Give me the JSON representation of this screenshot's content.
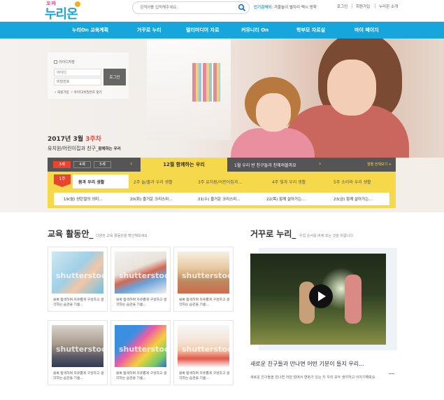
{
  "header": {
    "logo_small": "꼬마",
    "logo_main": "누리온",
    "search_placeholder": "검색어를 입력해주세요.",
    "hot_label": "인기검색어",
    "hot_text": ": 겨울놀이 별자리 팩시 방학",
    "util": [
      "로그인",
      "회원가입",
      "누리온 소개"
    ]
  },
  "nav": {
    "items": [
      "누리On 교육계획",
      "거꾸로 누리",
      "멀티미디어 자료",
      "커뮤니티 On",
      "학부모 자료실",
      "마이 페이지"
    ]
  },
  "login": {
    "keep": "아이디저장",
    "id_placeholder": "아이디",
    "pw_placeholder": "비밀번호",
    "button": "로그인",
    "link1": "회원가입",
    "link2": "아이디/비밀번호 찾기"
  },
  "hero": {
    "week_prefix": "2017년 3월 ",
    "week_highlight": "3주차",
    "subtitle": "유치원/어린이집과 친구_",
    "subtitle_small": "함께하는 우리"
  },
  "schedule": {
    "weeks": [
      "3세",
      "4세",
      "5세"
    ],
    "current": "12월 함께하는 우리",
    "next": "1월 우리 반 친구들과 친해져볼까요",
    "all_link": "월별 전체보기 +",
    "tag": "1주",
    "tabs": [
      "몸과 우리 생활",
      "2주 놀/출과 우리 생활",
      "3주 유치원/어린이집과...",
      "4주 빛과 우리 생활",
      "5주 소리와 우리 생활"
    ],
    "cells": [
      "19(월) 성탄절의 의미...",
      "20(화) 즐거운 크리스마...",
      "21(수) 즐거운 크리스마...",
      "22(목) 함께 살아가는...",
      "23(금) 함께 살아가는..."
    ]
  },
  "edu": {
    "title": "교육 활동안_",
    "subtitle": "다양한 교육 활동안을 확인해보세요",
    "cards": [
      {
        "text": "블록 탑색하며 자유롭게 구성하고 생각하는 습관을 기름..."
      },
      {
        "text": "블록 탑색하며 자유롭게 구성하고 생각하는 습관을 기름..."
      },
      {
        "text": "블록 탑색하며 자유롭게 구성하고 생각하는 습관을 기름..."
      },
      {
        "text": "블록 탑색하며 자유롭게 구성하고 생각하는 습관을 기름..."
      },
      {
        "text": "블록 탑색하며 자유롭게 구성하고 생각하는 습관을 기름..."
      },
      {
        "text": "블록 탑색하며 자유롭게 구성하고 생각하는 습관을 기름..."
      }
    ],
    "watermark": "shutterstock"
  },
  "reverse": {
    "title": "거꾸로 누리_",
    "subtitle": "수업 순서를 바꿔 또는 것을 비꿉니다.",
    "video_title": "새로운 친구들과 만나면 어떤 기분이 들지 우리...",
    "video_desc": "새로운 친구들을 만나면 어떤 점에서 변화가 있는 지 우리 모두 생각하고 이야기해봐요."
  },
  "colors": {
    "nav": "#17a6dc",
    "yellow": "#f6d94b",
    "red": "#e8442f"
  }
}
